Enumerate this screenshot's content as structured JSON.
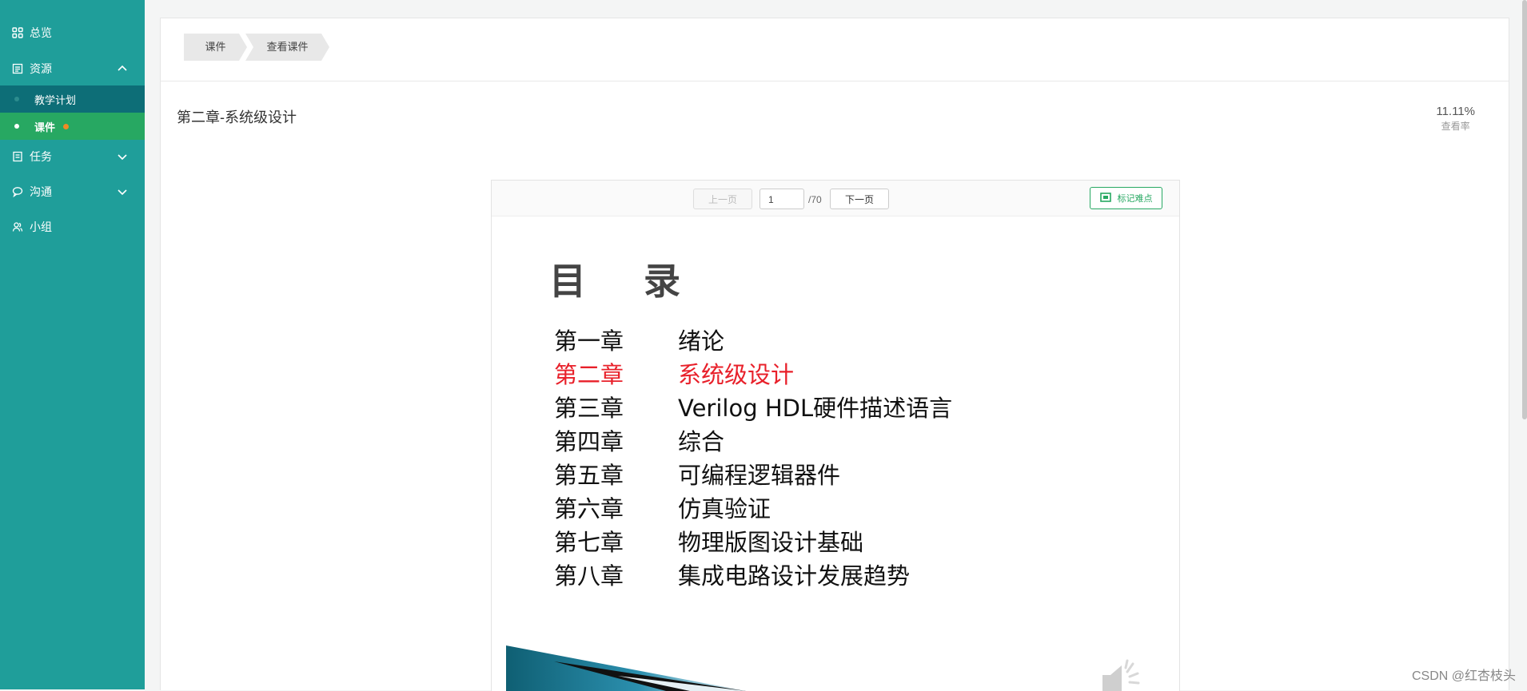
{
  "sidebar": {
    "items": [
      {
        "label": "总览",
        "icon": "grid-icon"
      },
      {
        "label": "资源",
        "icon": "resource-icon",
        "expanded": true
      },
      {
        "label": "任务",
        "icon": "task-icon",
        "expanded": false
      },
      {
        "label": "沟通",
        "icon": "chat-icon",
        "expanded": false
      },
      {
        "label": "小组",
        "icon": "group-icon"
      }
    ],
    "sub_items": [
      {
        "label": "教学计划"
      },
      {
        "label": "课件",
        "active": true
      }
    ],
    "colors": {
      "background": "#1f9e9a",
      "sub_bg": "#0d6e77",
      "active_bg": "#27a862",
      "badge": "#f08a24"
    }
  },
  "breadcrumb": [
    "课件",
    "查看课件"
  ],
  "page": {
    "title": "第二章-系统级设计",
    "view_rate": "11.11%",
    "view_rate_label": "查看率"
  },
  "viewer": {
    "prev_label": "上一页",
    "page_value": "1",
    "page_total": "/70",
    "next_label": "下一页",
    "mark_label": "标记难点"
  },
  "slide": {
    "heading": "目 录",
    "toc": [
      {
        "chapter": "第一章",
        "name": "绪论",
        "highlight": false
      },
      {
        "chapter": "第二章",
        "name": "系统级设计",
        "highlight": true
      },
      {
        "chapter": "第三章",
        "name": "Verilog HDL硬件描述语言",
        "highlight": false
      },
      {
        "chapter": "第四章",
        "name": "综合",
        "highlight": false
      },
      {
        "chapter": "第五章",
        "name": "可编程逻辑器件",
        "highlight": false
      },
      {
        "chapter": "第六章",
        "name": "仿真验证",
        "highlight": false
      },
      {
        "chapter": "第七章",
        "name": "物理版图设计基础",
        "highlight": false
      },
      {
        "chapter": "第八章",
        "name": "集成电路设计发展趋势",
        "highlight": false
      }
    ],
    "highlight_color": "#e8202a"
  },
  "watermark": "CSDN @红杏枝头"
}
